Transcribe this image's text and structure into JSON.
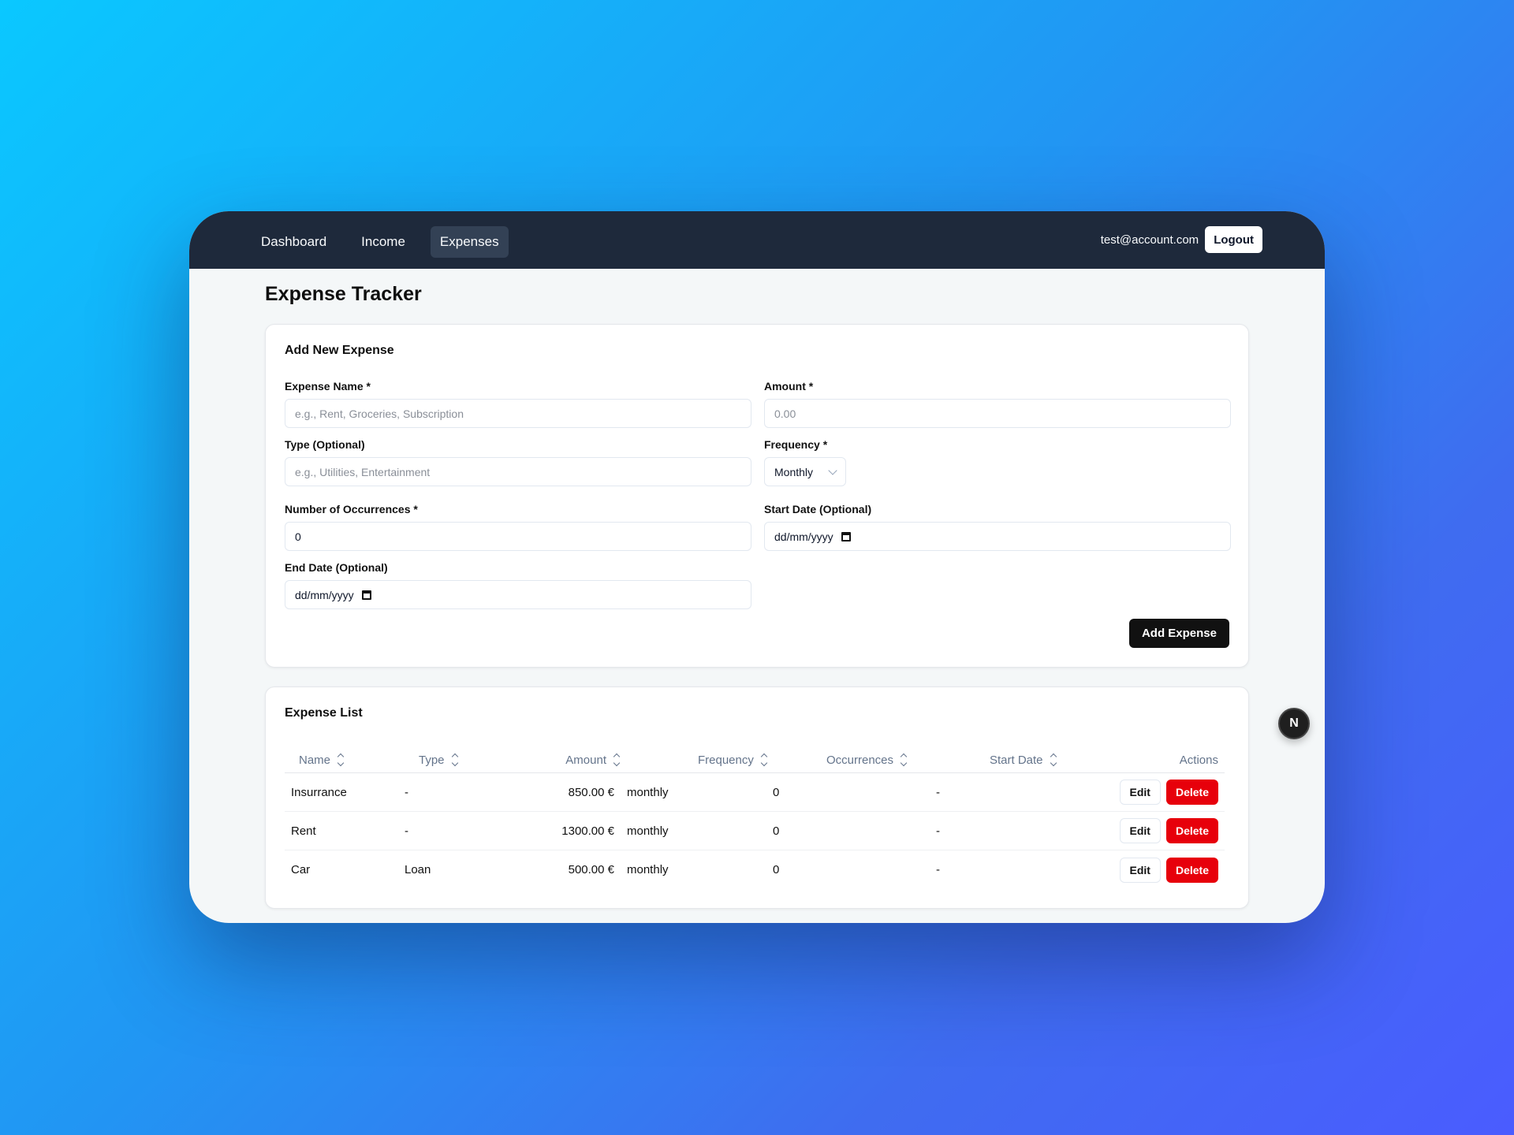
{
  "nav": {
    "links": [
      {
        "label": "Dashboard"
      },
      {
        "label": "Income"
      },
      {
        "label": "Expenses",
        "active": true
      }
    ],
    "user_email": "test@account.com",
    "logout_label": "Logout"
  },
  "page": {
    "title": "Expense Tracker"
  },
  "form": {
    "title": "Add New Expense",
    "name": {
      "label": "Expense Name *",
      "placeholder": "e.g., Rent, Groceries, Subscription",
      "value": ""
    },
    "amount": {
      "label": "Amount *",
      "placeholder": "0.00",
      "value": ""
    },
    "type": {
      "label": "Type (Optional)",
      "placeholder": "e.g., Utilities, Entertainment",
      "value": ""
    },
    "frequency": {
      "label": "Frequency *",
      "value": "Monthly"
    },
    "occurrences": {
      "label": "Number of Occurrences *",
      "value": "0"
    },
    "start_date": {
      "label": "Start Date (Optional)",
      "placeholder": "dd/mm/yyyy"
    },
    "end_date": {
      "label": "End Date (Optional)",
      "placeholder": "dd/mm/yyyy"
    },
    "submit_label": "Add Expense"
  },
  "list": {
    "title": "Expense List",
    "columns": [
      "Name",
      "Type",
      "Amount",
      "Frequency",
      "Occurrences",
      "Start Date",
      "Actions"
    ],
    "rows": [
      {
        "name": "Insurrance",
        "type": "-",
        "amount": "850.00 €",
        "frequency": "monthly",
        "occurrences": "0",
        "start_date": "-"
      },
      {
        "name": "Rent",
        "type": "-",
        "amount": "1300.00 €",
        "frequency": "monthly",
        "occurrences": "0",
        "start_date": "-"
      },
      {
        "name": "Car",
        "type": "Loan",
        "amount": "500.00 €",
        "frequency": "monthly",
        "occurrences": "0",
        "start_date": "-"
      }
    ],
    "edit_label": "Edit",
    "delete_label": "Delete"
  },
  "dev_badge": {
    "letter": "N"
  },
  "colors": {
    "navbar": "#1e293b",
    "delete": "#e7000b",
    "primary_button": "#111111"
  }
}
